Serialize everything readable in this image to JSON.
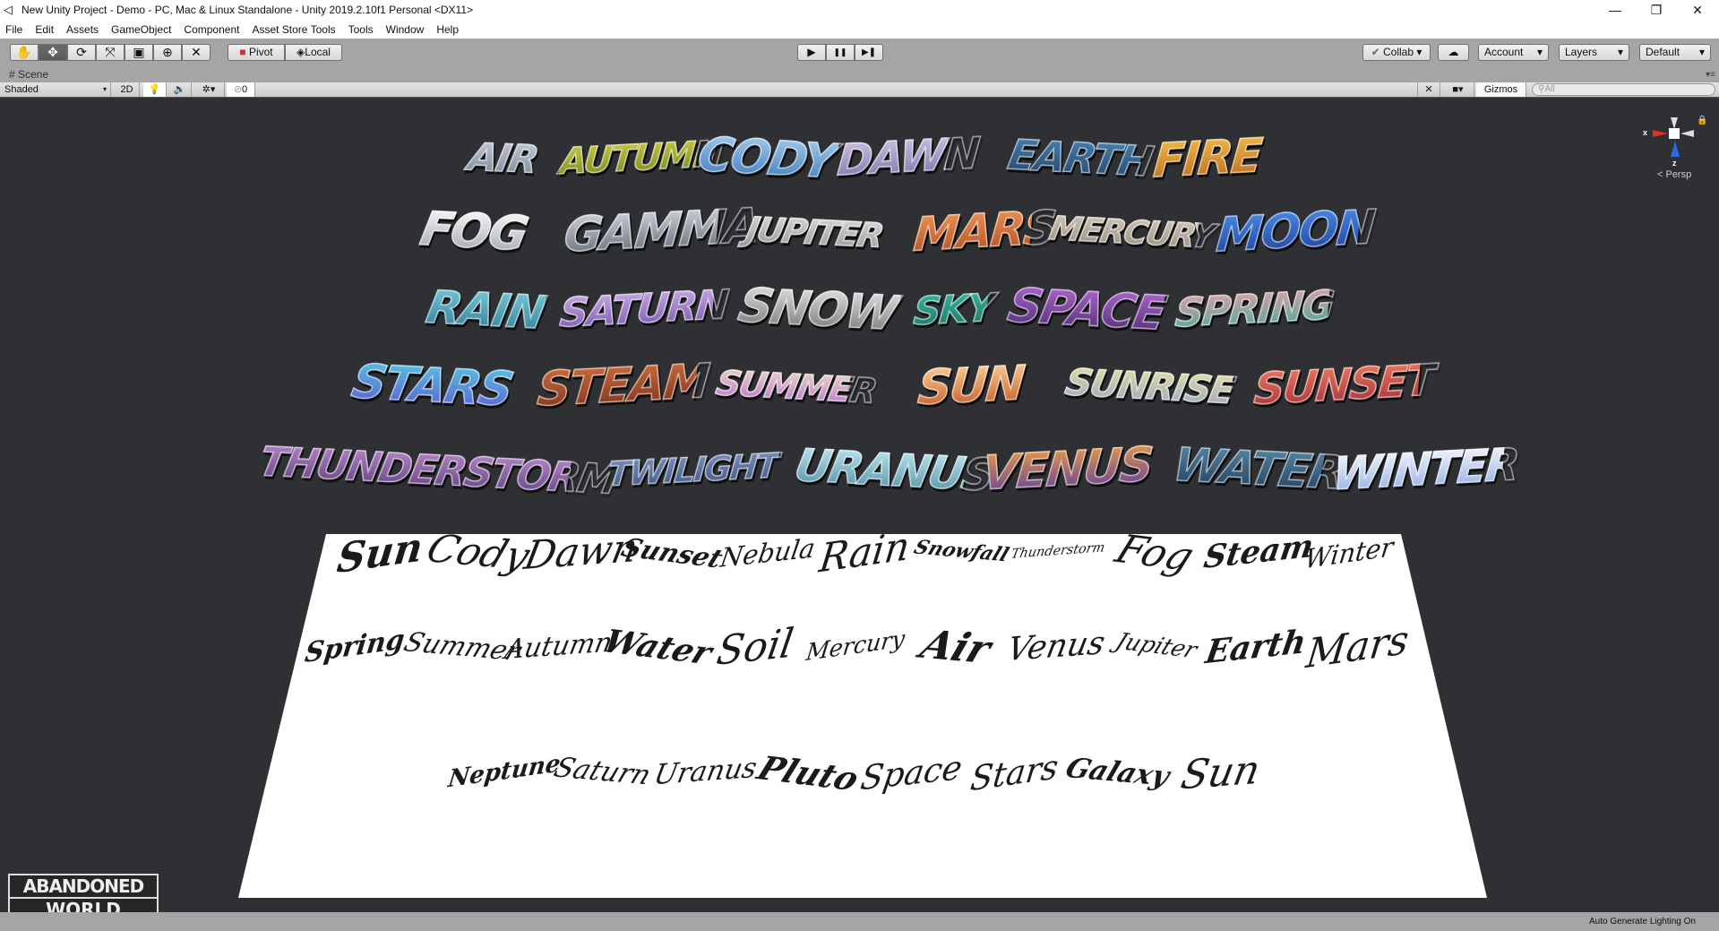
{
  "window": {
    "title": "New Unity Project - Demo - PC, Mac & Linux Standalone - Unity 2019.2.10f1 Personal <DX11>",
    "minimize": "—",
    "restore": "❐",
    "close": "✕"
  },
  "menu": [
    "File",
    "Edit",
    "Assets",
    "GameObject",
    "Component",
    "Asset Store Tools",
    "Tools",
    "Window",
    "Help"
  ],
  "toolbar": {
    "tools": [
      {
        "name": "hand-tool",
        "glyph": "✋"
      },
      {
        "name": "move-tool",
        "glyph": "✥"
      },
      {
        "name": "rotate-tool",
        "glyph": "⟳"
      },
      {
        "name": "scale-tool",
        "glyph": "⤧"
      },
      {
        "name": "rect-tool",
        "glyph": "▣"
      },
      {
        "name": "transform-tool",
        "glyph": "⊕"
      },
      {
        "name": "custom-tool",
        "glyph": "✕"
      }
    ],
    "pivot": "Pivot",
    "local": "Local",
    "play": "▶",
    "pause": "❚❚",
    "step": "▶❚",
    "collab": "Collab ▾",
    "cloud": "☁",
    "account": "Account",
    "layers": "Layers",
    "layout": "Default",
    "dropdown": "▾"
  },
  "scene": {
    "tab": "# Scene",
    "shading": "Shaded",
    "mode_2d": "2D",
    "hidden_count": "0",
    "gizmos": "Gizmos",
    "search_placeholder": "All",
    "persp": "< Persp",
    "axis_x": "x",
    "axis_z": "z"
  },
  "graffiti": [
    [
      {
        "t": "AIR",
        "c": [
          "#cfd8e0",
          "#6d7d8c"
        ]
      },
      {
        "t": "AUTUMN",
        "c": [
          "#d6d84a",
          "#6b7a1c"
        ]
      },
      {
        "t": "CODY",
        "c": [
          "#a8d0ee",
          "#3b78b8"
        ]
      },
      {
        "t": "DAWN",
        "c": [
          "#d9c8e8",
          "#6b6fa6"
        ]
      },
      {
        "t": "EARTH",
        "c": [
          "#4f88b8",
          "#1f3e63"
        ]
      },
      {
        "t": "FIRE",
        "c": [
          "#f2c24a",
          "#b8671c"
        ]
      }
    ],
    [
      {
        "t": "FOG",
        "c": [
          "#ffffff",
          "#9aa0a8"
        ]
      },
      {
        "t": "GAMMA",
        "c": [
          "#d6dbe2",
          "#5c6470"
        ]
      },
      {
        "t": "JUPITER",
        "c": [
          "#e9e9e9",
          "#8a8a8a"
        ]
      },
      {
        "t": "MARS",
        "c": [
          "#f09a5a",
          "#b04a1f"
        ]
      },
      {
        "t": "MERCURY",
        "c": [
          "#e0d7c8",
          "#8a7f70"
        ]
      },
      {
        "t": "MOON",
        "c": [
          "#4d8ee8",
          "#1b3f9a"
        ]
      }
    ],
    [
      {
        "t": "RAIN",
        "c": [
          "#7fd0e0",
          "#2b7a92"
        ]
      },
      {
        "t": "SATURN",
        "c": [
          "#d6b8f0",
          "#6a4aa0"
        ]
      },
      {
        "t": "SNOW",
        "c": [
          "#e8e8e8",
          "#6f6f6f"
        ]
      },
      {
        "t": "SKY",
        "c": [
          "#3cc0a8",
          "#1b6a5c"
        ]
      },
      {
        "t": "SPACE",
        "c": [
          "#b36ad0",
          "#4a2a70"
        ]
      },
      {
        "t": "SPRING",
        "c": [
          "#f0a0b0",
          "#3aa890"
        ]
      }
    ],
    [
      {
        "t": "STARS",
        "c": [
          "#58c8e0",
          "#5a5ad0"
        ]
      },
      {
        "t": "STEAM",
        "c": [
          "#d07040",
          "#7a3018"
        ]
      },
      {
        "t": "SUMMER",
        "c": [
          "#f4f0c0",
          "#b060d0"
        ]
      },
      {
        "t": "SUN",
        "c": [
          "#ffd8a0",
          "#c0501a"
        ]
      },
      {
        "t": "SUNRISE",
        "c": [
          "#f4e8a0",
          "#8aa0c0"
        ]
      },
      {
        "t": "SUNSET",
        "c": [
          "#f08060",
          "#a02838"
        ]
      }
    ],
    [
      {
        "t": "THUNDERSTORM",
        "c": [
          "#c090d0",
          "#5a3a7a"
        ]
      },
      {
        "t": "TWILIGHT",
        "c": [
          "#8aa0c8",
          "#364a78"
        ]
      },
      {
        "t": "URANUS",
        "c": [
          "#c8f0f8",
          "#4a8aa0"
        ]
      },
      {
        "t": "VENUS",
        "c": [
          "#f0a040",
          "#5a3aa0"
        ]
      },
      {
        "t": "WATER",
        "c": [
          "#5a8aa8",
          "#1e3a58"
        ]
      },
      {
        "t": "WINTER",
        "c": [
          "#ffffff",
          "#8aa8e0"
        ]
      }
    ]
  ],
  "tags": [
    [
      "Sun",
      "Cody",
      "Dawn",
      "Sunset",
      "Nebula",
      "Rain",
      "Snowfall",
      "Thunderstorm",
      "Fog",
      "Steam",
      "Winter"
    ],
    [
      "Spring",
      "Summer",
      "Autumn",
      "Water",
      "Soil",
      "Mercury",
      "Air",
      "Venus",
      "Jupiter",
      "Earth",
      "Mars"
    ],
    [
      "Neptune",
      "Saturn",
      "Uranus",
      "Pluto",
      "Space",
      "Stars",
      "Galaxy",
      "Sun"
    ]
  ],
  "logo": {
    "line1": "ABANDONED",
    "line2": "WORLD"
  },
  "status": {
    "lighting": "Auto Generate Lighting On"
  }
}
